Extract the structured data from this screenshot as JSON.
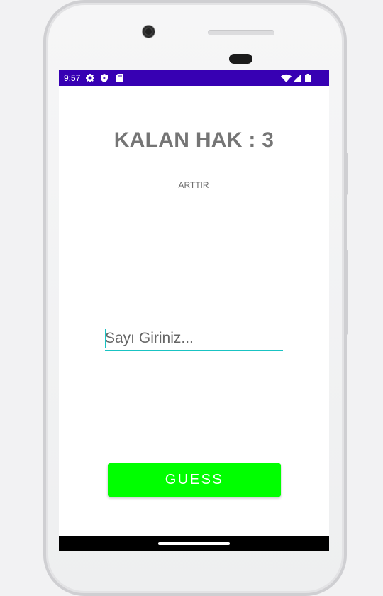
{
  "status_bar": {
    "time": "9:57",
    "left_icons": [
      "gear-icon",
      "shield-icon",
      "sd-card-icon"
    ],
    "right_icons": [
      "wifi-icon",
      "signal-icon",
      "battery-icon"
    ],
    "background_color": "#3700b3"
  },
  "main": {
    "title": "KALAN HAK : 3",
    "arttir_label": "ARTTIR",
    "guess_input": {
      "value": "",
      "placeholder": "Sayı Giriniz..."
    },
    "guess_button_label": "GUESS",
    "guess_button_color": "#00ff00",
    "accent_color": "#19c3c3"
  }
}
